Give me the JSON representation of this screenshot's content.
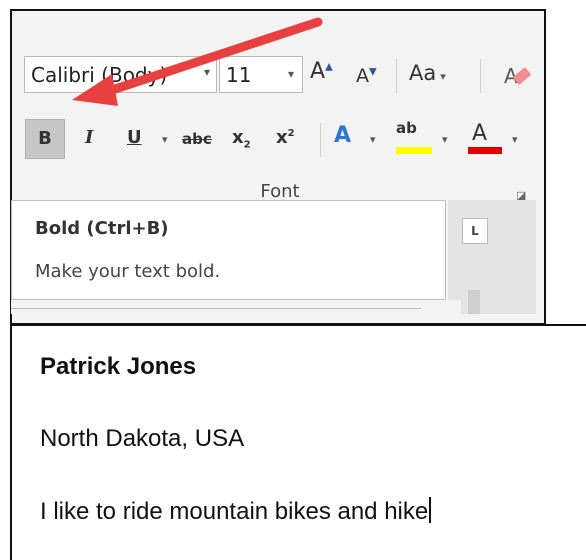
{
  "ribbon": {
    "font_name": "Calibri (Body)",
    "font_size": "11",
    "grow_label": "A",
    "shrink_label": "A",
    "case_label": "Aa",
    "bold_label": "B",
    "italic_label": "I",
    "underline_label": "U",
    "strike_label": "abc",
    "subscript_label": "x",
    "subscript_mark": "2",
    "superscript_label": "x",
    "superscript_mark": "2",
    "effects_label": "A",
    "highlight_label": "ab",
    "font_color_label": "A",
    "group_label": "Font",
    "highlight_color": "#ffff00",
    "font_color": "#e00000"
  },
  "tooltip": {
    "title": "Bold (Ctrl+B)",
    "description": "Make your text bold."
  },
  "document": {
    "name": "Patrick Jones",
    "location": "North Dakota, USA",
    "hobby": "I like to ride mountain bikes and hike"
  },
  "annotation": {
    "arrow_color": "#e8403f"
  }
}
